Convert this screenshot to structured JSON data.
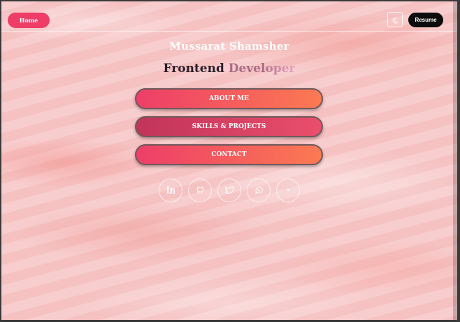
{
  "nav": {
    "home_label": "Home",
    "resume_label": "Resume",
    "theme_icon": "moon-icon"
  },
  "hero": {
    "name": "Mussarat Shamsher",
    "role_word1": "Frontend",
    "role_word2": "Devel",
    "role_word3": "oper"
  },
  "menu": {
    "about_label": "ABOUT ME",
    "skills_label": "SKILLS & PROJECTS",
    "contact_label": "CONTACT"
  },
  "social": [
    {
      "icon": "linkedin-icon"
    },
    {
      "icon": "github-icon"
    },
    {
      "icon": "twitter-icon"
    },
    {
      "icon": "whatsapp-icon"
    },
    {
      "icon": "arrow-down-icon"
    }
  ],
  "colors": {
    "accent": "#ee3e68",
    "accent_end": "#fb7a52",
    "background": "#f7c7c8"
  }
}
